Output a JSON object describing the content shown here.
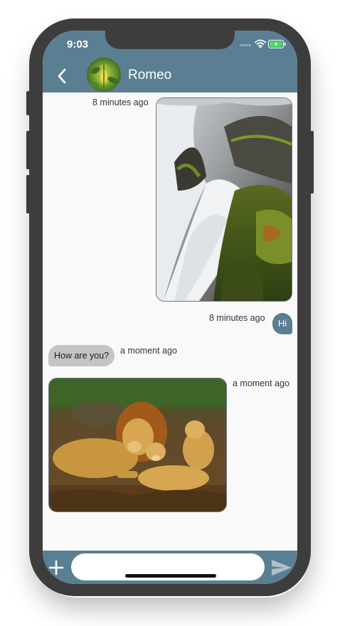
{
  "status_bar": {
    "time": "9:03"
  },
  "header": {
    "contact_name": "Romeo"
  },
  "messages": [
    {
      "direction": "outgoing",
      "type": "image",
      "image": "waterfall-photo",
      "time": "8 minutes ago"
    },
    {
      "direction": "outgoing",
      "type": "text",
      "text": "Hi",
      "time": "8 minutes ago"
    },
    {
      "direction": "incoming",
      "type": "text",
      "text": "How are you?",
      "time": "a moment ago"
    },
    {
      "direction": "incoming",
      "type": "image",
      "image": "lion-family-photo",
      "time": "a moment ago"
    }
  ],
  "composer": {
    "value": "",
    "placeholder": ""
  },
  "icons": {
    "back": "chevron-left-icon",
    "add": "plus-icon",
    "send": "send-icon",
    "wifi": "wifi-icon",
    "battery": "battery-charging-icon",
    "signal": "signal-dots-icon"
  },
  "colors": {
    "header": "#5a7f92",
    "chat_background": "#f9f9f9",
    "outgoing_bubble": "#5a7f92",
    "incoming_bubble": "#c4c4c4",
    "phone_frame": "#3d3d3d",
    "battery_fill": "#4cd964"
  }
}
